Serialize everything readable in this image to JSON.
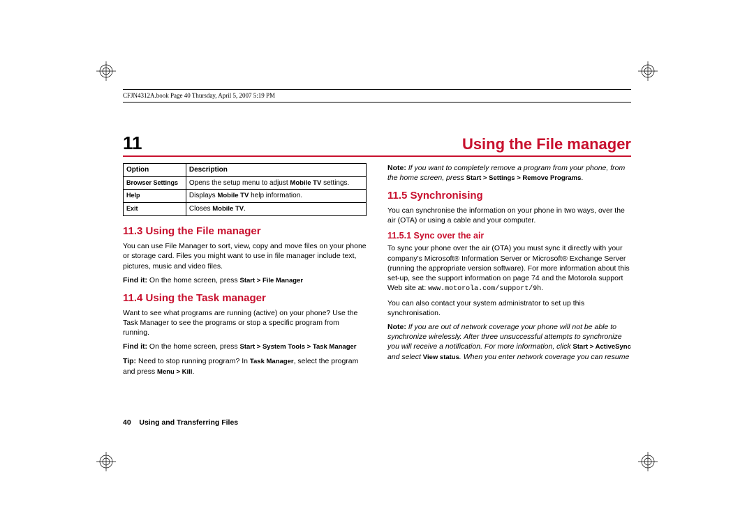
{
  "meta_header": "CFJN4312A.book  Page 40  Thursday, April 5, 2007  5:19 PM",
  "chapter": {
    "number": "11",
    "title": "Using the File manager"
  },
  "table": {
    "headers": [
      "Option",
      "Description"
    ],
    "rows": [
      {
        "option": "Browser Settings",
        "desc_pre": "Opens the setup menu to adjust ",
        "desc_bold": "Mobile TV",
        "desc_post": " settings."
      },
      {
        "option": "Help",
        "desc_pre": "Displays ",
        "desc_bold": "Mobile TV",
        "desc_post": " help information."
      },
      {
        "option": "Exit",
        "desc_pre": "Closes ",
        "desc_bold": "Mobile TV",
        "desc_post": "."
      }
    ]
  },
  "s113": {
    "heading": "11.3 Using the File manager",
    "body": "You can use File Manager to sort, view, copy and move files on your phone or storage card. Files you might want to use in file manager include text, pictures, music and video files.",
    "findit_label": "Find it:",
    "findit_text": " On the home screen, press ",
    "findit_path": "Start > File Manager"
  },
  "s114": {
    "heading": "11.4 Using the Task manager",
    "body": "Want to see what programs are running (active) on your phone? Use the Task Manager to see the programs or stop a specific program from running.",
    "findit_label": "Find it:",
    "findit_text": " On the home screen, press ",
    "findit_path": "Start > System Tools > Task Manager",
    "tip_label": "Tip:",
    "tip_text1": " Need to stop running program? In ",
    "tip_bold1": "Task Manager",
    "tip_text2": ", select the program and press ",
    "tip_bold2": "Menu > Kill",
    "tip_text3": "."
  },
  "right_note": {
    "label": "Note:",
    "text1": " If you want to completely remove a program from your phone, from the home screen, press ",
    "bold1": "Start > Settings > Remove Programs",
    "text2": "."
  },
  "s115": {
    "heading": "11.5 Synchronising",
    "body": "You can synchronise the information on your phone in two ways, over the air (OTA) or using a cable and your computer."
  },
  "s1151": {
    "heading": "11.5.1 Sync over the air",
    "body1": "To sync your phone over the air (OTA) you must sync it directly with your company's Microsoft® Information Server or Microsoft® Exchange Server (running the appropriate version software). For more information about this set-up, see the support information on page 74 and the Motorola support Web site at: ",
    "url": "www.motorola.com/support/9h",
    "dot": ".",
    "body2": "You can also contact your system administrator to set up this synchronisation.",
    "note_label": "Note:",
    "note_text1": " If you are out of network coverage your phone will not be able to synchronize wirelessly. After three unsuccessful attempts to synchronize you will receive a notification. For more information, click ",
    "note_bold1": "Start > ActiveSync",
    "note_text2": " and select ",
    "note_bold2": "View status",
    "note_text3": ". When you enter network coverage you can resume"
  },
  "footer": {
    "page": "40",
    "label": "Using and Transferring Files"
  }
}
